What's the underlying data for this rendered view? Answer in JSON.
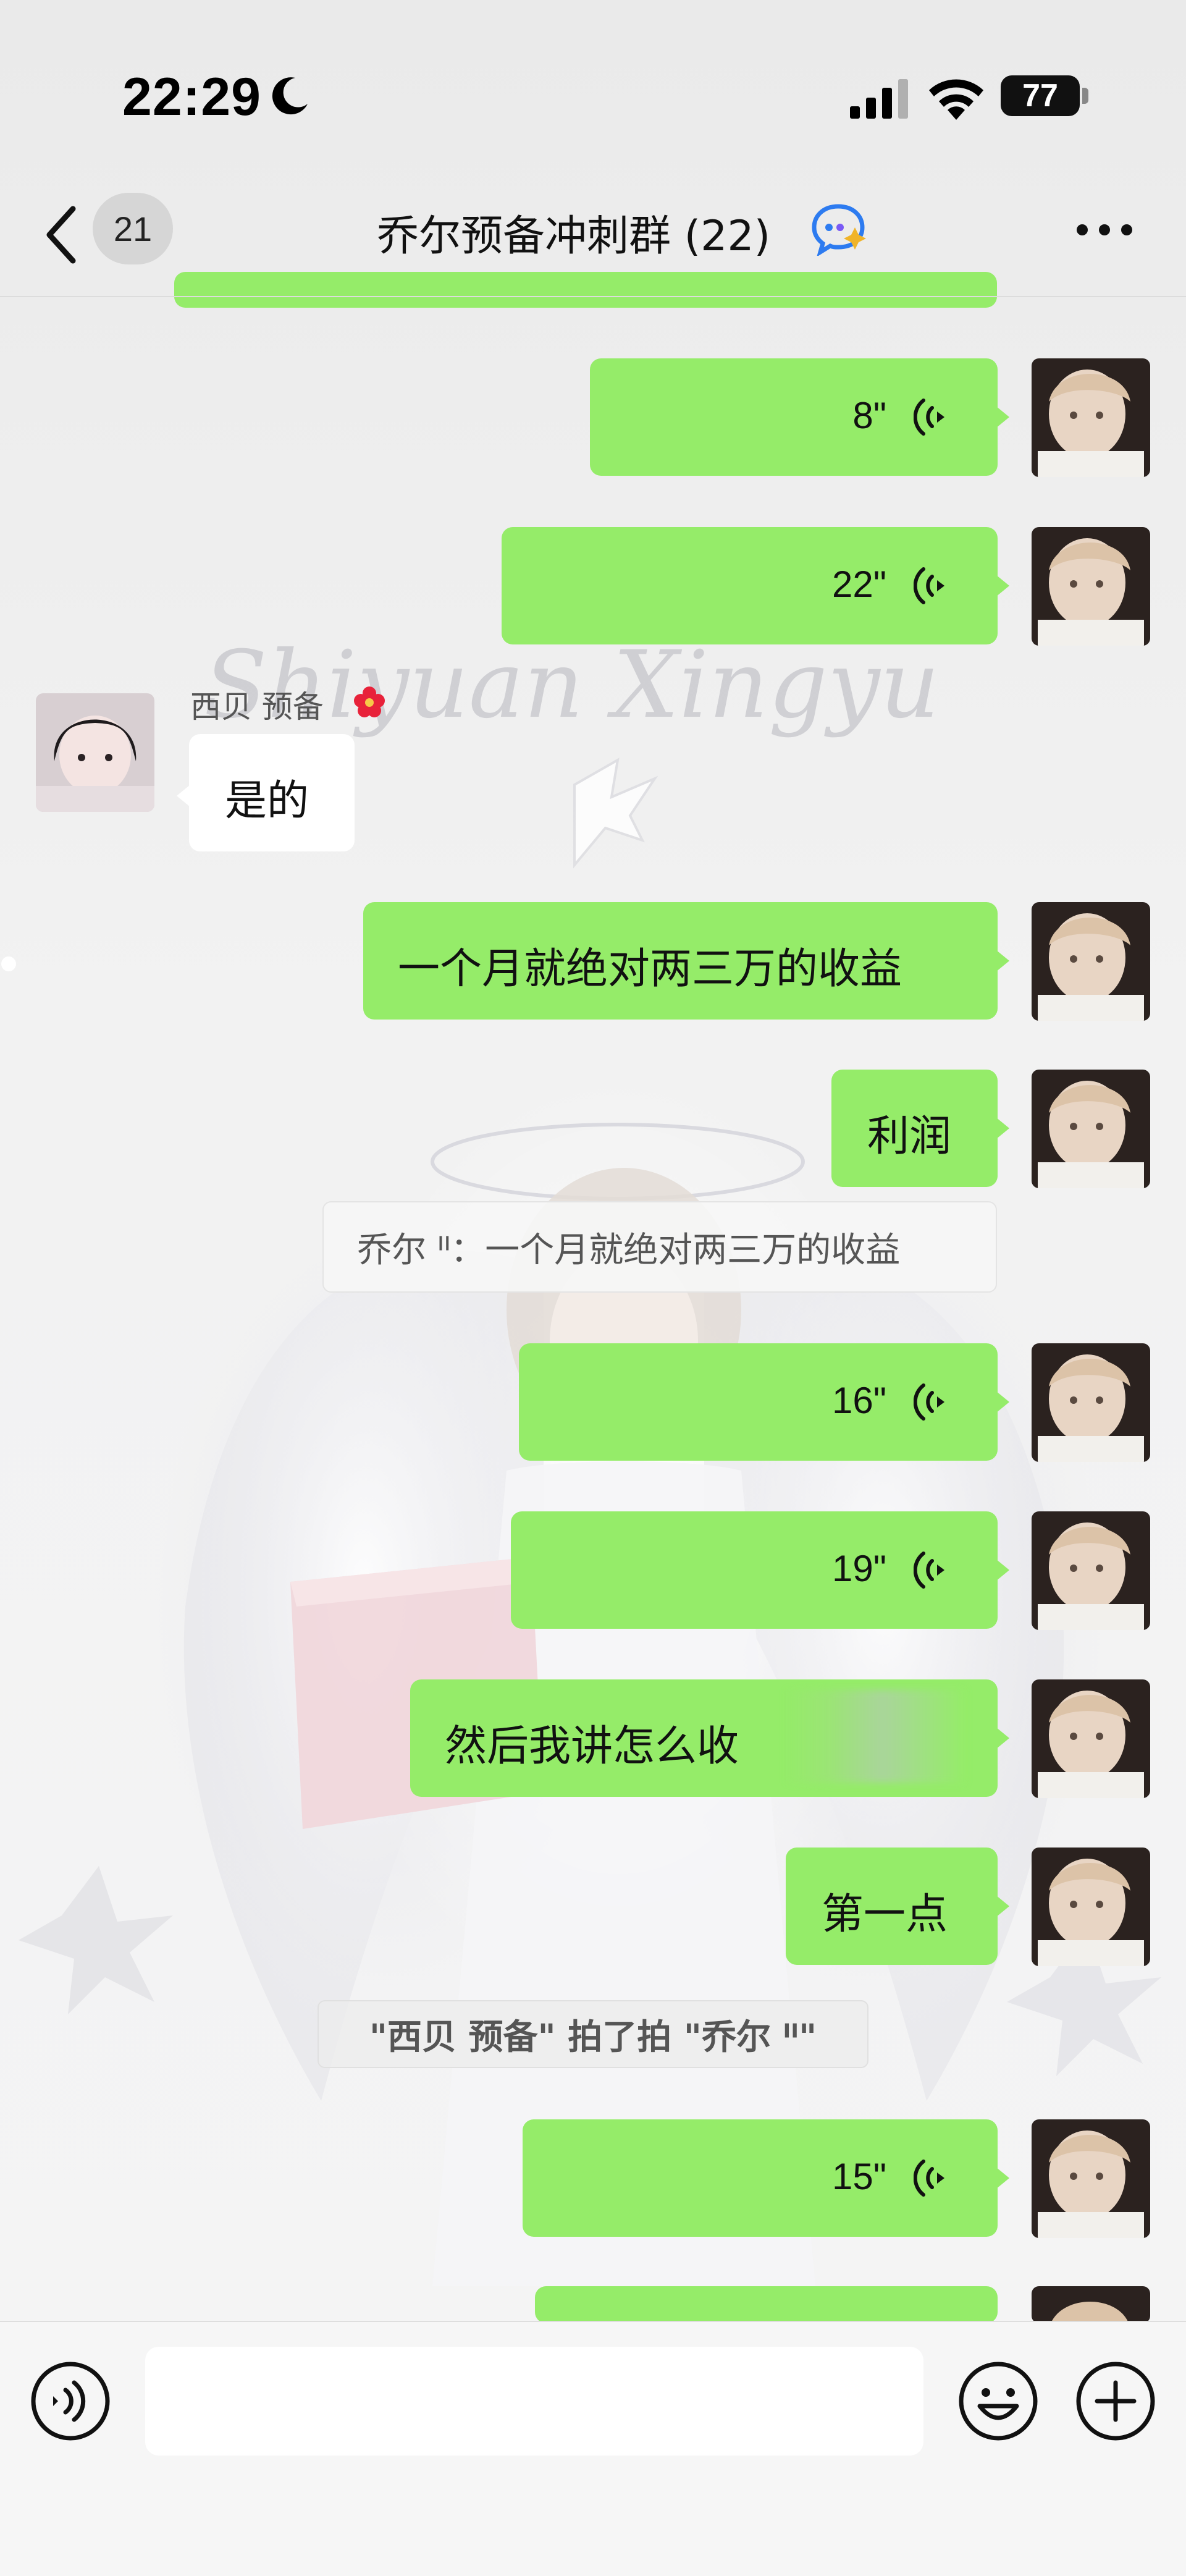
{
  "status_bar": {
    "time": "22:29",
    "battery": "77",
    "icons": [
      "moon-icon",
      "signal-icon",
      "wifi-icon",
      "battery-icon"
    ]
  },
  "header": {
    "back_icon": "chevron-left-icon",
    "unread_count": "21",
    "title": "乔尔预备冲刺群 (22)",
    "ai_icon": "chat-ai-icon",
    "more_icon": "more-icon"
  },
  "watermark": "Shiyuan Xingyu",
  "messages": [
    {
      "type": "voice",
      "direction": "out",
      "duration": "8\""
    },
    {
      "type": "voice",
      "direction": "out",
      "duration": "22\""
    },
    {
      "type": "text",
      "direction": "in",
      "sender": "西贝 预备",
      "text": "是的"
    },
    {
      "type": "text",
      "direction": "out",
      "text": "一个月就绝对两三万的收益"
    },
    {
      "type": "text",
      "direction": "out",
      "text": "利润",
      "quote": "乔尔 ᑊᑊ：一个月就绝对两三万的收益"
    },
    {
      "type": "voice",
      "direction": "out",
      "duration": "16\""
    },
    {
      "type": "voice",
      "direction": "out",
      "duration": "19\""
    },
    {
      "type": "text",
      "direction": "out",
      "text": "然后我讲怎么收",
      "partially_obscured": true
    },
    {
      "type": "text",
      "direction": "out",
      "text": "第一点"
    },
    {
      "type": "system",
      "text": "\"西贝 预备\" 拍了拍 \"乔尔 ᑊᑊ\""
    },
    {
      "type": "voice",
      "direction": "out",
      "duration": "15\""
    }
  ],
  "input_bar": {
    "voice_toggle_icon": "voice-toggle-icon",
    "input_value": "",
    "emoji_icon": "emoji-icon",
    "add_icon": "plus-circle-icon"
  },
  "colors": {
    "outgoing_bubble": "#95ec69",
    "incoming_bubble": "#ffffff",
    "background": "#ececec"
  }
}
